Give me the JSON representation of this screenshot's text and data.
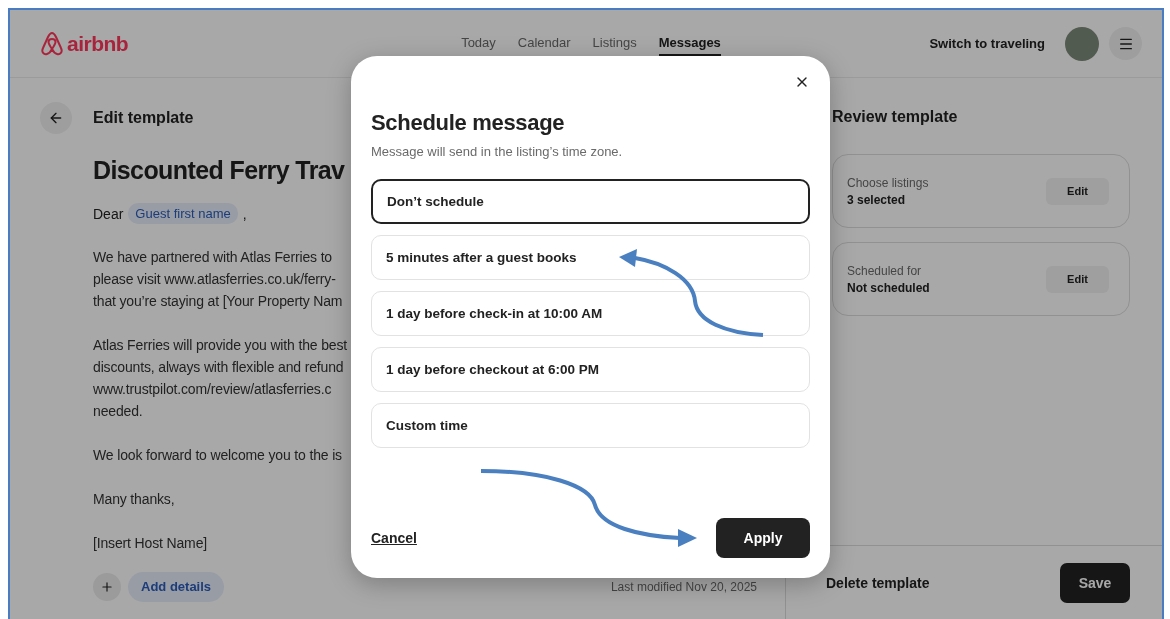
{
  "header": {
    "logo": "airbnb",
    "nav": [
      {
        "label": "Today",
        "selected": false
      },
      {
        "label": "Calendar",
        "selected": false
      },
      {
        "label": "Listings",
        "selected": false
      },
      {
        "label": "Messages",
        "selected": true
      }
    ],
    "switch_link": "Switch to traveling"
  },
  "editor": {
    "heading": "Edit template",
    "title": "Discounted Ferry Trav",
    "greeting": {
      "text": "Dear",
      "chip": "Guest first name",
      "punctuation": ","
    },
    "paragraphs": [
      [
        "We have partnered with Atlas Ferries to",
        "please visit www.atlasferries.co.uk/ferry-",
        "that you’re staying at [Your Property Nam"
      ],
      [
        "Atlas Ferries will provide you with the best",
        "discounts, always with flexible and refund",
        "www.trustpilot.com/review/atlasferries.c",
        "needed."
      ],
      [
        "We look forward to welcome you to the is"
      ],
      [
        "Many thanks,"
      ],
      [
        "[Insert Host Name]"
      ]
    ],
    "add_details": "Add details",
    "last_modified": "Last modified Nov 20, 2025"
  },
  "review": {
    "heading": "Review template",
    "cards": [
      {
        "label": "Choose listings",
        "value": "3 selected",
        "button": "Edit"
      },
      {
        "label": "Scheduled for",
        "value": "Not scheduled",
        "button": "Edit"
      }
    ],
    "delete": "Delete template",
    "save": "Save"
  },
  "modal": {
    "title": "Schedule message",
    "subtitle": "Message will send in the listing’s time zone.",
    "options": [
      {
        "label": "Don’t schedule",
        "selected": true
      },
      {
        "label": "5 minutes after a guest books",
        "selected": false
      },
      {
        "label": "1 day before check-in at 10:00 AM",
        "selected": false
      },
      {
        "label": "1 day before checkout at 6:00 PM",
        "selected": false
      },
      {
        "label": "Custom time",
        "selected": false
      }
    ],
    "cancel": "Cancel",
    "apply": "Apply"
  }
}
